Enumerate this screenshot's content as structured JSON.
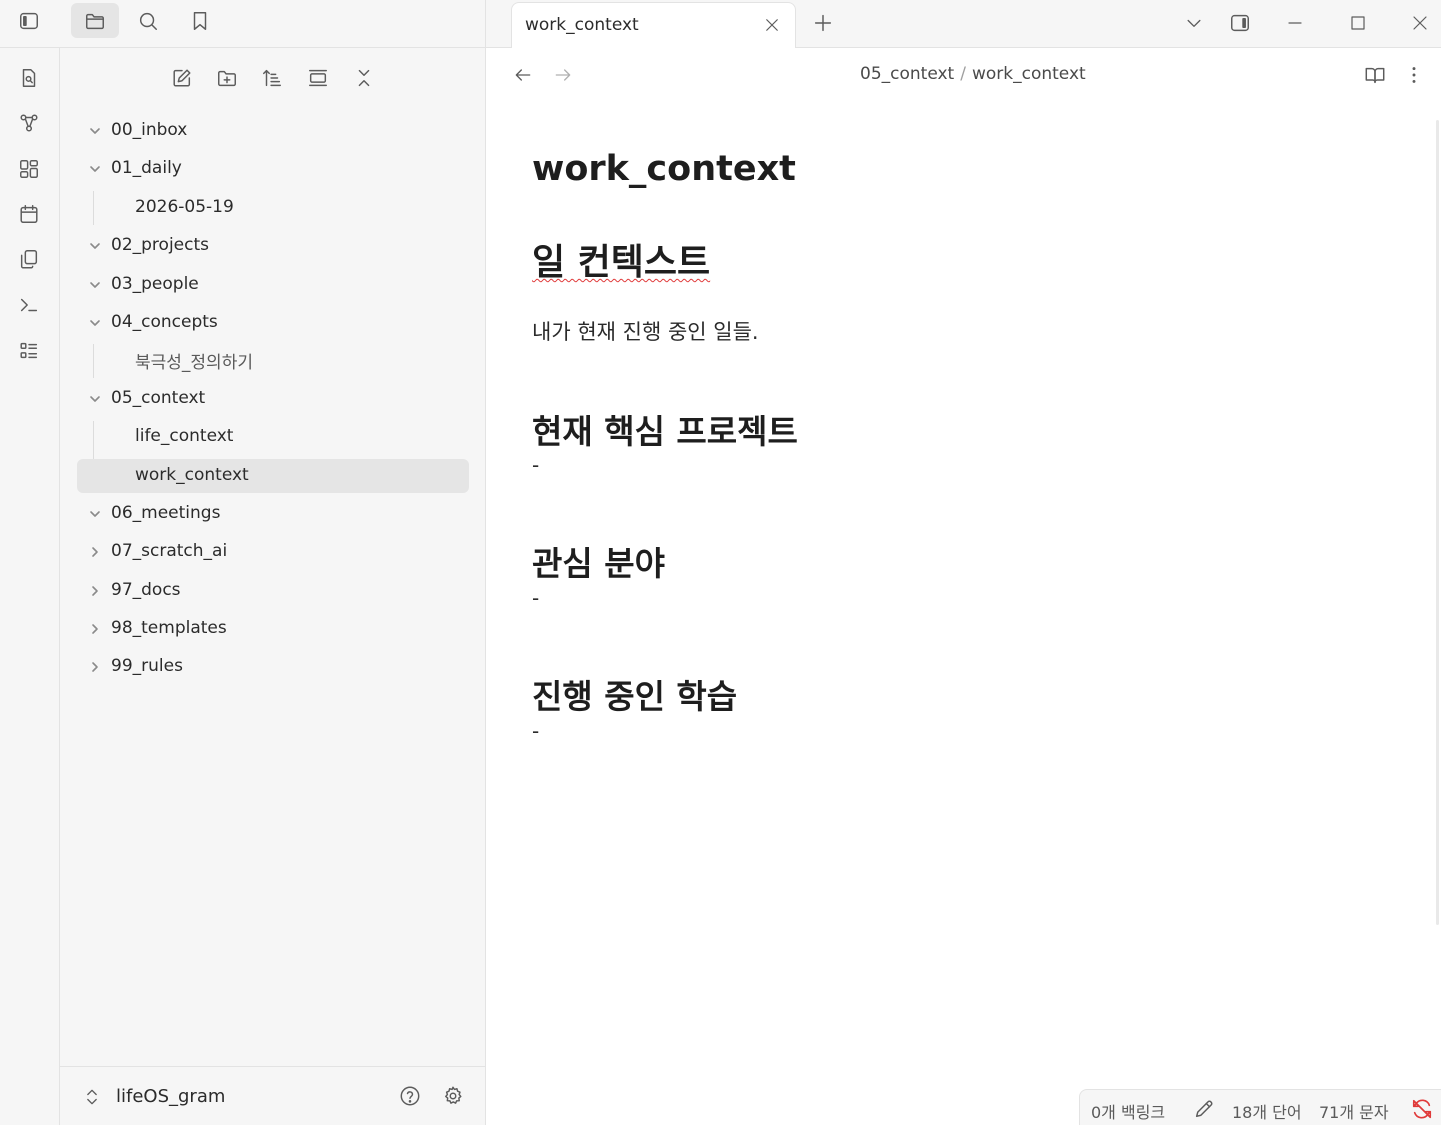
{
  "tab": {
    "title": "work_context"
  },
  "breadcrumb": {
    "folder": "05_context",
    "separator": "/",
    "file": "work_context"
  },
  "sidebar": {
    "items": [
      {
        "label": "00_inbox"
      },
      {
        "label": "01_daily"
      },
      {
        "label": "2026-05-19"
      },
      {
        "label": "02_projects"
      },
      {
        "label": "03_people"
      },
      {
        "label": "04_concepts"
      },
      {
        "label": "북극성_정의하기"
      },
      {
        "label": "05_context"
      },
      {
        "label": "life_context"
      },
      {
        "label": "work_context"
      },
      {
        "label": "06_meetings"
      },
      {
        "label": "07_scratch_ai"
      },
      {
        "label": "97_docs"
      },
      {
        "label": "98_templates"
      },
      {
        "label": "99_rules"
      }
    ],
    "active_item": "work_context"
  },
  "vault": {
    "name": "lifeOS_gram"
  },
  "note": {
    "title": "work_context",
    "heading": "일 컨텍스트",
    "intro": "내가 현재 진행 중인 일들.",
    "sections": [
      {
        "heading": "현재 핵심 프로젝트",
        "body": "-"
      },
      {
        "heading": "관심 분야",
        "body": "-"
      },
      {
        "heading": "진행 중인 학습",
        "body": "-"
      }
    ]
  },
  "status": {
    "backlinks": "0개 백링크",
    "words": "18개 단어",
    "characters": "71개 문자"
  },
  "icons": {
    "ribbon": [
      "daily-note-icon",
      "graph-view-icon",
      "canvas-icon",
      "calendar-icon",
      "copy-icon",
      "terminal-icon",
      "outline-icon"
    ],
    "top": [
      "sidebar-toggle-icon",
      "folder-icon",
      "search-icon",
      "bookmark-icon"
    ],
    "nav": [
      "new-note-icon",
      "new-folder-icon",
      "sort-icon",
      "collapse-view-icon",
      "collapse-all-icon"
    ]
  },
  "colors": {
    "accent_spellcheck": "#e03a3a",
    "active_bg": "#e5e5e5",
    "sync_error": "#e03a3a"
  }
}
